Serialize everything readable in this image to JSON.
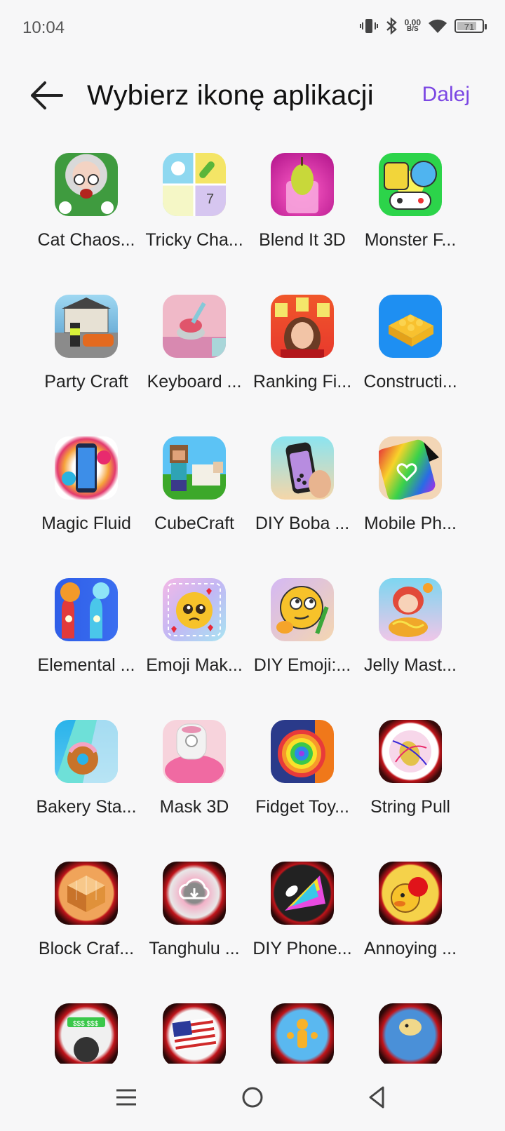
{
  "status": {
    "time": "10:04",
    "net_speed": "0,00",
    "net_unit": "B/S",
    "battery": "71"
  },
  "header": {
    "title": "Wybierz ikonę aplikacji",
    "next_label": "Dalej",
    "accent": "#7b47e3"
  },
  "apps": [
    {
      "label": "Cat Chaos...",
      "icon": "granny-cat-icon"
    },
    {
      "label": "Tricky Cha...",
      "icon": "tricky-challenge-icon"
    },
    {
      "label": "Blend It 3D",
      "icon": "pear-blender-icon"
    },
    {
      "label": "Monster F...",
      "icon": "monster-gamepad-icon"
    },
    {
      "label": "Party Craft",
      "icon": "party-craft-house-icon"
    },
    {
      "label": "Keyboard ...",
      "icon": "keyboard-key-icon"
    },
    {
      "label": "Ranking Fi...",
      "icon": "ranking-filter-girl-icon"
    },
    {
      "label": "Constructi...",
      "icon": "lego-brick-icon"
    },
    {
      "label": "Magic Fluid",
      "icon": "magic-fluid-phone-icon"
    },
    {
      "label": "CubeCraft",
      "icon": "cubecraft-sheep-icon"
    },
    {
      "label": "DIY Boba ...",
      "icon": "boba-phone-icon"
    },
    {
      "label": "Mobile Ph...",
      "icon": "rainbow-phone-case-icon"
    },
    {
      "label": "Elemental ...",
      "icon": "elemental-hands-icon"
    },
    {
      "label": "Emoji Mak...",
      "icon": "pleading-emoji-icon"
    },
    {
      "label": "DIY Emoji:...",
      "icon": "thinking-emoji-icon"
    },
    {
      "label": "Jelly Mast...",
      "icon": "jelly-noodle-girl-icon"
    },
    {
      "label": "Bakery Sta...",
      "icon": "donut-runner-icon"
    },
    {
      "label": "Mask 3D",
      "icon": "mask-machine-icon"
    },
    {
      "label": "Fidget Toy...",
      "icon": "pop-it-fidget-icon"
    },
    {
      "label": "String Pull",
      "icon": "string-pull-icon"
    },
    {
      "label": "Block Craf...",
      "icon": "block-craft-icon"
    },
    {
      "label": "Tanghulu ...",
      "icon": "tanghulu-download-icon"
    },
    {
      "label": "DIY Phone...",
      "icon": "diy-phone-spray-icon"
    },
    {
      "label": "Annoying ...",
      "icon": "annoying-duck-icon"
    },
    {
      "label": "",
      "icon": "money-wheel-icon"
    },
    {
      "label": "",
      "icon": "usa-flag-icon"
    },
    {
      "label": "",
      "icon": "crowd-runner-icon"
    },
    {
      "label": "",
      "icon": "fish-bowl-icon"
    }
  ],
  "nav": {
    "menu_icon": "menu-icon",
    "home_icon": "home-icon",
    "back_icon": "back-triangle-icon"
  }
}
